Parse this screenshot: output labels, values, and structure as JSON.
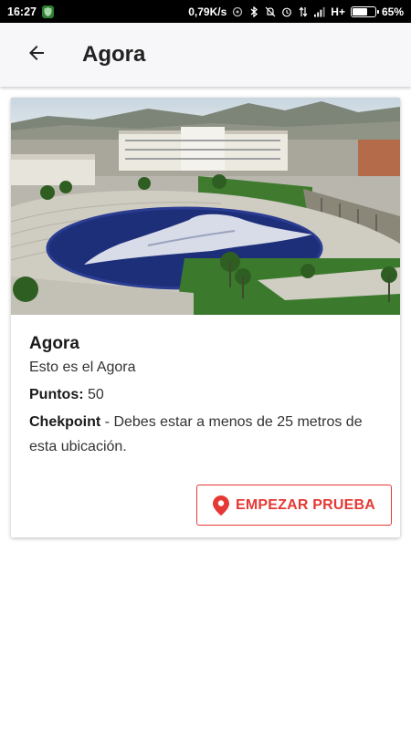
{
  "status_bar": {
    "time": "16:27",
    "speed": "0,79K/s",
    "network": "H+",
    "battery_pct": "65%",
    "battery_level": 0.65,
    "icons": [
      "shield-icon",
      "vpn-icon",
      "bluetooth-icon",
      "mute-icon",
      "alarm-icon",
      "data-arrows-icon",
      "signal-icon",
      "battery-icon"
    ]
  },
  "app_bar": {
    "title": "Agora",
    "back_icon": "arrow-back-icon"
  },
  "card": {
    "image_alt": "Agora",
    "title": "Agora",
    "subtitle": "Esto es el Agora",
    "points_label": "Puntos:",
    "points_value": "50",
    "checkpoint_label": "Chekpoint",
    "checkpoint_text": " - Debes estar a menos de 25 metros de esta ubicación.",
    "button_label": "EMPEZAR PRUEBA",
    "button_icon": "location-pin-icon"
  },
  "colors": {
    "accent": "#e53935",
    "app_bar_bg": "#f7f7f9",
    "status_bar_bg": "#000000"
  }
}
